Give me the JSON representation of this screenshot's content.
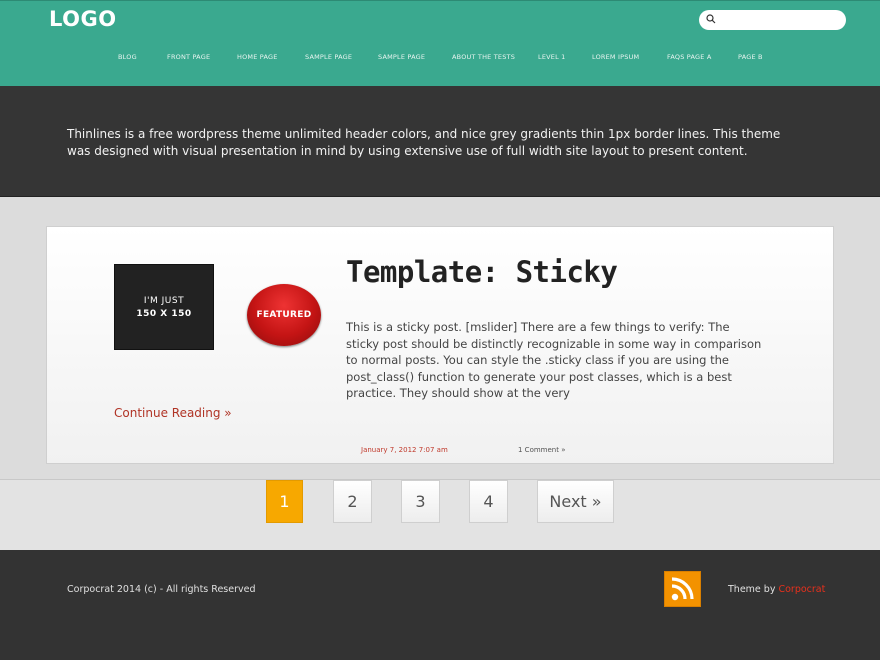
{
  "header": {
    "logo": "LOGO",
    "search_placeholder": "",
    "nav": [
      "BLOG",
      "FRONT PAGE",
      "HOME PAGE",
      "SAMPLE PAGE",
      "SAMPLE PAGE",
      "ABOUT THE TESTS",
      "LEVEL 1",
      "LOREM IPSUM",
      "FAQS PAGE A",
      "PAGE B"
    ]
  },
  "intro": {
    "text": "Thinlines is a free wordpress theme unlimited header colors, and nice grey gradients thin 1px border lines. This theme was designed with visual presentation in mind by using extensive use of full width site layout to present content."
  },
  "post": {
    "thumb_line1": "I'M JUST",
    "thumb_line2": "150 X 150",
    "featured_badge": "FEATURED",
    "title": "Template: Sticky",
    "excerpt": "This is a sticky post. [mslider] There are a few things to verify: The sticky post should be distinctly recognizable in some way in comparison to normal posts. You can style the .sticky class if you are using the post_class() function to generate your post classes, which is a best practice. They should show at the very",
    "continue_label": "Continue Reading »",
    "date": "January 7, 2012 7:07 am",
    "comments": "1 Comment »"
  },
  "pagination": {
    "pages": [
      "1",
      "2",
      "3",
      "4"
    ],
    "next_label": "Next »",
    "current": "1"
  },
  "footer": {
    "copyright": "Corpocrat 2014 (c) - All rights Reserved",
    "theme_by_prefix": "Theme by ",
    "theme_by_link": "Corpocrat"
  },
  "colors": {
    "header_bg": "#3aa98f",
    "dark_band": "#353535",
    "accent_red": "#c0392b",
    "active_page": "#f7a800",
    "rss_orange": "#f39200"
  }
}
